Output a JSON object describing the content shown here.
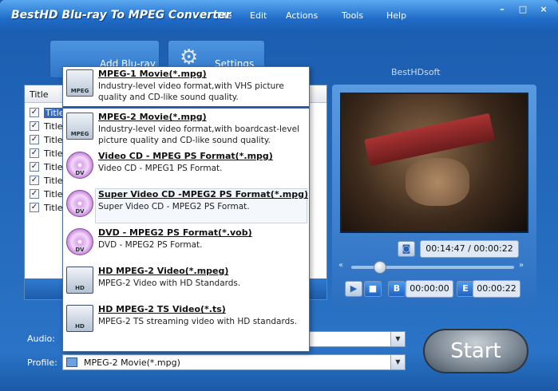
{
  "app": {
    "title": "BestHD Blu-ray To MPEG Converter",
    "brand": "BestHDsoft"
  },
  "menu": [
    "File",
    "Edit",
    "Actions",
    "Tools",
    "Help"
  ],
  "toolbar": {
    "add_label": "Add Blu-ray",
    "settings_label": "Settings"
  },
  "list": {
    "header": "Title",
    "rows": [
      "Title_",
      "Title_",
      "Title_",
      "Title_",
      "Title_",
      "Title_",
      "Title_",
      "Title_"
    ]
  },
  "player": {
    "current_time": "00:14:47",
    "total_time": "00:00:22",
    "b_time": "00:00:00",
    "e_time": "00:00:22",
    "progress_fraction": 0.17
  },
  "bottom": {
    "audio_label": "Audio:",
    "profile_label": "Profile:",
    "profile_value": "MPEG-2 Movie(*.mpg)",
    "start_label": "Start"
  },
  "formats": [
    {
      "title": "MPEG-1 Movie(*.mpg)",
      "desc": "Industry-level video format,with VHS picture quality and CD-like sound quality.",
      "icon": "mpeg-icon"
    },
    {
      "title": "MPEG-2 Movie(*.mpg)",
      "desc": "Industry-level video format,with boardcast-level picture quality and CD-like sound quality.",
      "icon": "mpeg-icon"
    },
    {
      "title": "Video CD - MPEG PS Format(*.mpg)",
      "desc": "Video CD - MPEG1 PS Format.",
      "icon": "dvd-disc-icon"
    },
    {
      "title": "Super Video CD -MPEG2 PS Format(*.mpg)",
      "desc": "Super Video CD - MPEG2 PS Format.",
      "icon": "dvd-disc-icon"
    },
    {
      "title": "DVD - MPEG2 PS Format(*.vob)",
      "desc": "DVD - MPEG2 PS Format.",
      "icon": "dvd-disc-icon"
    },
    {
      "title": "HD MPEG-2 Video(*.mpeg)",
      "desc": "MPEG-2 Video with HD Standards.",
      "icon": "hd-mpeg-icon"
    },
    {
      "title": "HD MPEG-2 TS Video(*.ts)",
      "desc": "MPEG-2 TS streaming video with HD standards.",
      "icon": "hd-mpeg-icon"
    }
  ]
}
